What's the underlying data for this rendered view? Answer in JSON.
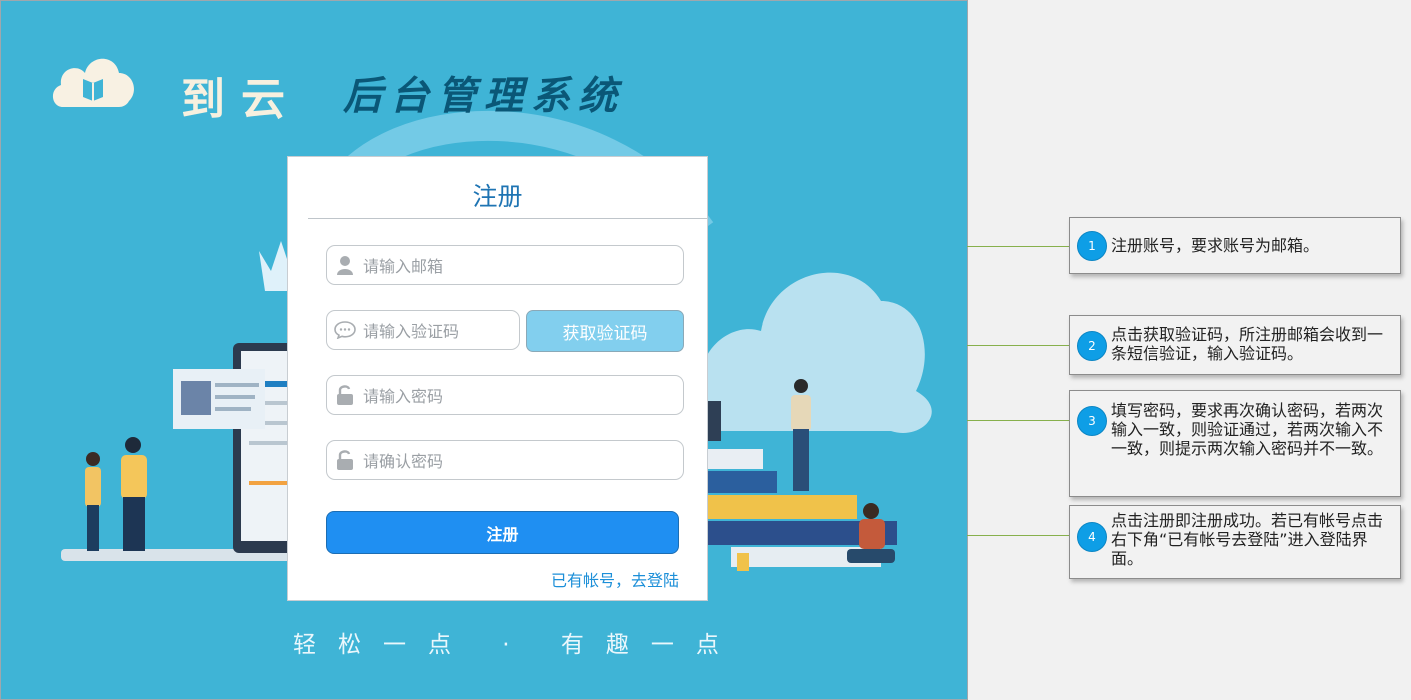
{
  "header": {
    "logo_icon": "cloud-book-icon",
    "brand": "到云",
    "system_name": "后台管理系统"
  },
  "register": {
    "title": "注册",
    "email_placeholder": "请输入邮箱",
    "code_placeholder": "请输入验证码",
    "get_code_label": "获取验证码",
    "password_placeholder": "请输入密码",
    "confirm_placeholder": "请确认密码",
    "submit_label": "注册",
    "login_link": "已有帐号，去登陆"
  },
  "slogan": "轻松一点 · 有趣一点",
  "callouts": [
    {
      "num": "1",
      "text": "注册账号，要求账号为邮箱。"
    },
    {
      "num": "2",
      "text": "点击获取验证码，所注册邮箱会收到一条短信验证，输入验证码。"
    },
    {
      "num": "3",
      "text": "填写密码，要求再次确认密码，若两次输入一致，则验证通过，若两次输入不一致，则提示两次输入密码并不一致。"
    },
    {
      "num": "4",
      "text": "点击注册即注册成功。若已有帐号点击右下角“已有帐号去登陆”进入登陆界面。"
    }
  ],
  "colors": {
    "background": "#3fb4d6",
    "accent": "#1f8ff2",
    "code_button": "#82cfee",
    "callout_badge": "#0e9ee6",
    "connector": "#87b04c"
  }
}
